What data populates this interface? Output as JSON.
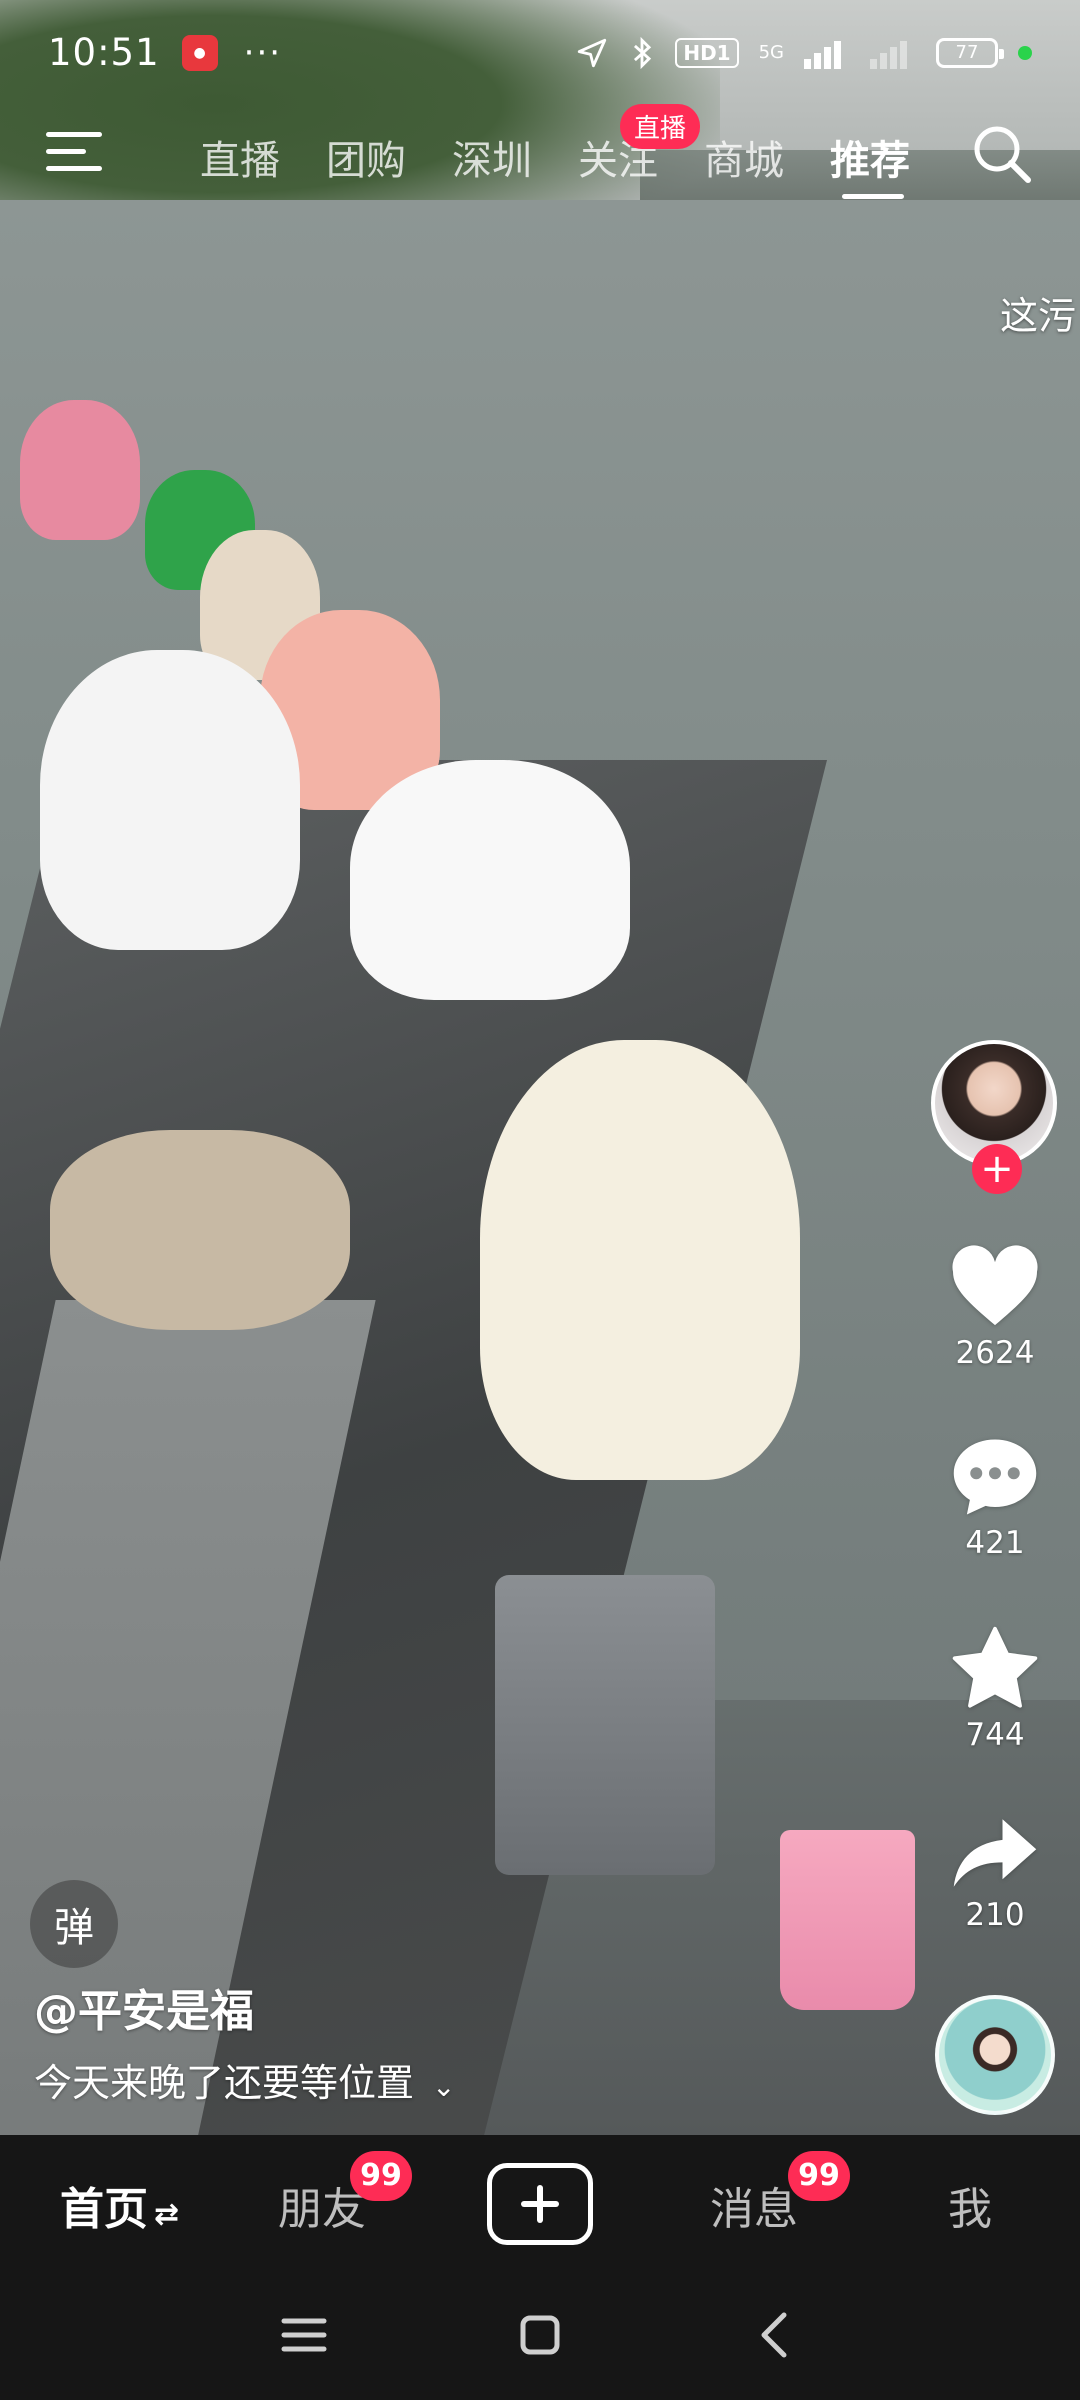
{
  "status_bar": {
    "time": "10:51",
    "more": "···",
    "hd": "HD1",
    "network": "5G",
    "battery": "77",
    "icons": [
      "location-arrow-icon",
      "bluetooth-icon",
      "signal-icon",
      "wifi-off-signal-icon",
      "battery-icon"
    ]
  },
  "top_nav": {
    "tabs": [
      {
        "label": "直播"
      },
      {
        "label": "团购"
      },
      {
        "label": "深圳"
      },
      {
        "label": "关注"
      },
      {
        "label": "商城"
      },
      {
        "label": "推荐"
      }
    ],
    "active_tab": "推荐",
    "live_badge": "直播",
    "caption_peek": "这污"
  },
  "rail": {
    "follow_symbol": "+",
    "likes": "2624",
    "comments": "421",
    "favorites": "744",
    "shares": "210"
  },
  "video_info": {
    "danmaku_symbol": "弹",
    "author": "@平安是福",
    "description": "今天来晚了还要等位置",
    "expand_symbol": "⌄"
  },
  "tabbar": {
    "home": "首页",
    "friends": "朋友",
    "friends_badge": "99",
    "messages": "消息",
    "messages_badge": "99",
    "me": "我"
  },
  "colors": {
    "accent": "#fe2c55",
    "tabbar_bg": "#161616",
    "status_dot": "#2ad34b"
  }
}
